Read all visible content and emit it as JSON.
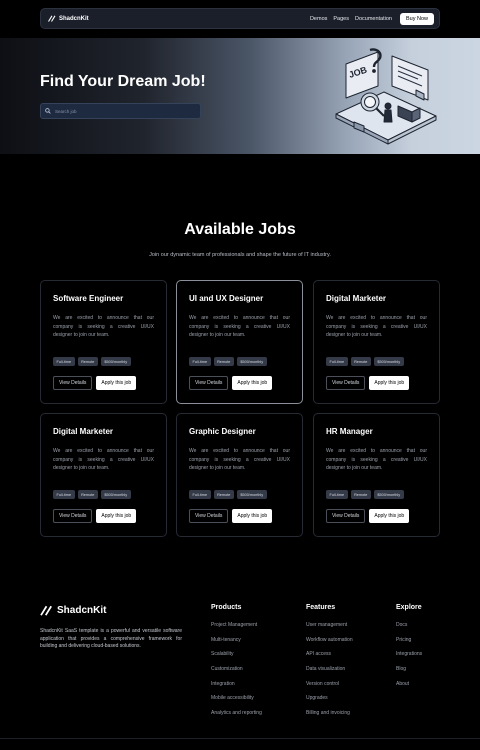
{
  "nav": {
    "brand": "ShadcnKit",
    "links": [
      "Demos",
      "Pages",
      "Documentation"
    ],
    "cta": "Buy Now"
  },
  "hero": {
    "title": "Find Your Dream Job!",
    "search_placeholder": "Search job",
    "illustration_text": "JOB"
  },
  "jobs": {
    "title": "Available Jobs",
    "subtitle": "Join our dynamic team of professionals and shape the future of IT industry.",
    "cards": [
      {
        "title": "Software Engineer",
        "desc": "We are excited to announce that our company is seeking a creative UI/UX designer to join our team.",
        "tags": [
          "Full-time",
          "Remote",
          "$500/monthly"
        ],
        "details": "View Details",
        "apply": "Apply this job"
      },
      {
        "title": "UI and UX Designer",
        "desc": "We are excited to announce that our company is seeking a creative UI/UX designer to join our team.",
        "tags": [
          "Full-time",
          "Remote",
          "$500/monthly"
        ],
        "details": "View Details",
        "apply": "Apply this job"
      },
      {
        "title": "Digital Marketer",
        "desc": "We are excited to announce that our company is seeking a creative UI/UX designer to join our team.",
        "tags": [
          "Full-time",
          "Remote",
          "$500/monthly"
        ],
        "details": "View Details",
        "apply": "Apply this job"
      },
      {
        "title": "Digital Marketer",
        "desc": "We are excited to announce that our company is seeking a creative UI/UX designer to join our team.",
        "tags": [
          "Full-time",
          "Remote",
          "$500/monthly"
        ],
        "details": "View Details",
        "apply": "Apply this job"
      },
      {
        "title": "Graphic Designer",
        "desc": "We are excited to announce that our company is seeking a creative UI/UX designer to join our team.",
        "tags": [
          "Full-time",
          "Remote",
          "$500/monthly"
        ],
        "details": "View Details",
        "apply": "Apply this job"
      },
      {
        "title": "HR Manager",
        "desc": "We are excited to announce that our company is seeking a creative UI/UX designer to join our team.",
        "tags": [
          "Full-time",
          "Remote",
          "$500/monthly"
        ],
        "details": "View Details",
        "apply": "Apply this job"
      }
    ]
  },
  "footer": {
    "brand": "ShadcnKit",
    "description": "ShadcnKit SaaS template is a powerful and versatile software application that provides a comprehensive framework for building and delivering cloud-based solutions.",
    "columns": [
      {
        "heading": "Products",
        "items": [
          "Project Management",
          "Multi-tenancy",
          "Scalability",
          "Customization",
          "Integration",
          "Mobile accessibility",
          "Analytics and reporting"
        ]
      },
      {
        "heading": "Features",
        "items": [
          "User management",
          "Workflow automation",
          "API access",
          "Data visualization",
          "Version control",
          "Upgrades",
          "Billing and invoicing"
        ]
      },
      {
        "heading": "Explore",
        "items": [
          "Docs",
          "Pricing",
          "Integrations",
          "Blog",
          "About"
        ]
      }
    ]
  }
}
